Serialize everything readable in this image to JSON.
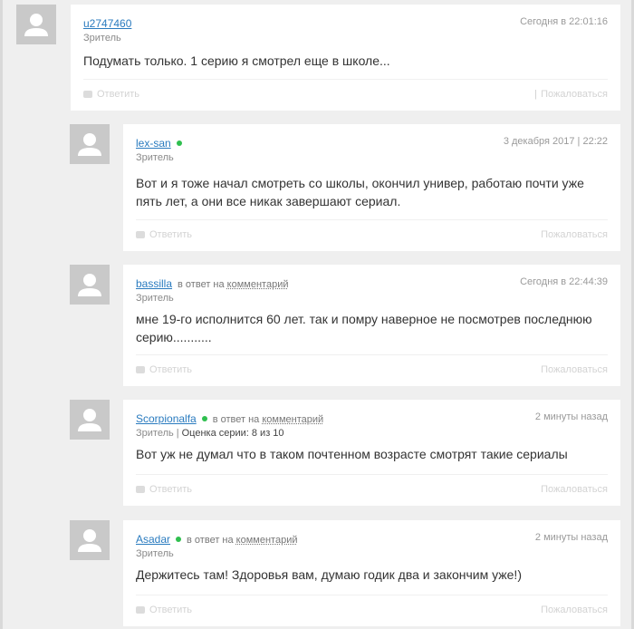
{
  "comments": [
    {
      "username": "u2747460",
      "role": "Зритель",
      "date": "Сегодня в 22:01:16",
      "text": "Подумать только. 1 серию я смотрел еще в школе...",
      "reply_label": "Ответить",
      "complain_label": "Пожаловаться",
      "separator": "|"
    },
    {
      "username": "lex-san",
      "role": "Зритель",
      "date": "3 декабря 2017 | 22:22",
      "text": "Вот и я тоже начал смотреть со школы, окончил универ, работаю почти уже пять лет, а они все никак завершают сериал.",
      "reply_label": "Ответить",
      "complain_label": "Пожаловаться"
    },
    {
      "username": "bassilla",
      "reply_prefix": "в ответ на",
      "reply_target": "комментарий",
      "role": "Зритель",
      "date": "Сегодня в 22:44:39",
      "text": "мне 19-го исполнится 60 лет. так и помру наверное не посмотрев последнюю серию...........",
      "reply_label": "Ответить",
      "complain_label": "Пожаловаться"
    },
    {
      "username": "Scorpionalfa",
      "reply_prefix": "в ответ на",
      "reply_target": "комментарий",
      "role": "Зритель",
      "role_separator": "|",
      "rating": "Оценка серии: 8 из 10",
      "date": "2 минуты назад",
      "text": "Вот уж не думал что в таком почтенном возрасте смотрят такие сериалы",
      "reply_label": "Ответить",
      "complain_label": "Пожаловаться"
    },
    {
      "username": "Asadar",
      "reply_prefix": "в ответ на",
      "reply_target": "комментарий",
      "role": "Зритель",
      "date": "2 минуты назад",
      "text": "Держитесь там! Здоровья вам, думаю годик два и закончим уже!)",
      "reply_label": "Ответить",
      "complain_label": "Пожаловаться"
    }
  ],
  "colors": {
    "username": "#2a7bbf",
    "online": "#2fbf4f",
    "background": "#efefef",
    "card": "#ffffff"
  }
}
